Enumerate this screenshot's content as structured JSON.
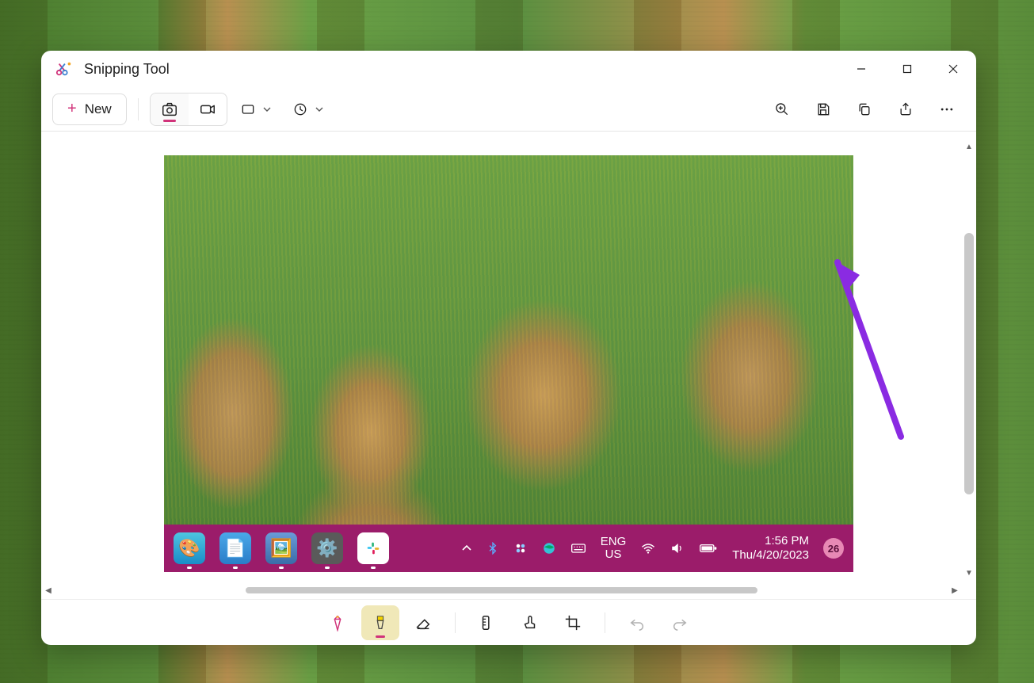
{
  "app": {
    "title": "Snipping Tool"
  },
  "toolbar": {
    "new_label": "New"
  },
  "captured_taskbar": {
    "lang_line1": "ENG",
    "lang_line2": "US",
    "time": "1:56 PM",
    "date": "Thu/4/20/2023",
    "notification_count": "26"
  }
}
